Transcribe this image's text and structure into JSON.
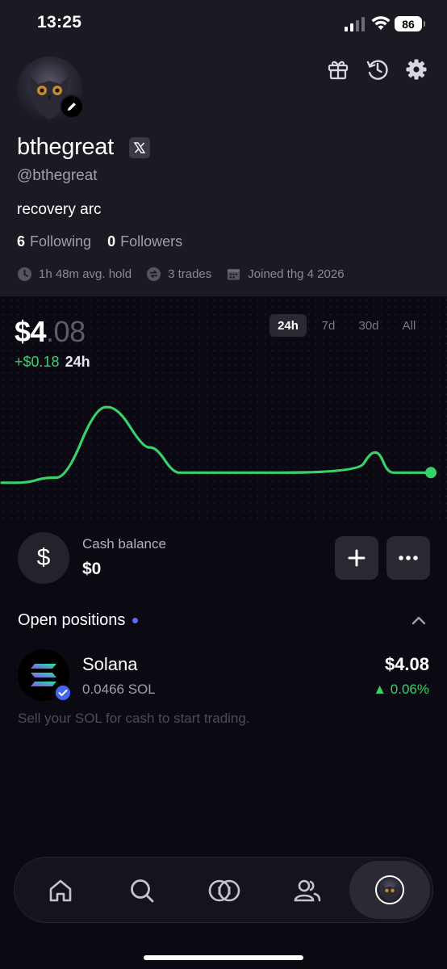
{
  "status_bar": {
    "time": "13:25",
    "battery": "86"
  },
  "profile": {
    "username": "bthegreat",
    "handle": "@bthegreat",
    "bio": "recovery arc",
    "following_count": "6",
    "following_label": "Following",
    "followers_count": "0",
    "followers_label": "Followers",
    "stats": {
      "avg_hold": "1h 48m avg. hold",
      "trades": "3 trades",
      "joined": "Joined thg 4 2026"
    }
  },
  "portfolio": {
    "value_main": "$4",
    "value_cents": ".08",
    "change": "+$0.18",
    "change_period": "24h",
    "ranges": [
      "24h",
      "7d",
      "30d",
      "All"
    ],
    "selected_range": "24h",
    "line_color": "#3ad06a"
  },
  "chart_data": {
    "type": "line",
    "title": "",
    "xlabel": "",
    "ylabel": "",
    "x": [
      0,
      6,
      10,
      15,
      22,
      27,
      33,
      36,
      40,
      43,
      83,
      86,
      88,
      90,
      93,
      100
    ],
    "values": [
      4.0,
      4.0,
      4.01,
      4.01,
      4.15,
      4.15,
      4.07,
      4.07,
      4.02,
      4.02,
      4.02,
      4.06,
      4.06,
      4.02,
      4.02,
      4.02
    ],
    "ylim": [
      3.99,
      4.16
    ],
    "grid": false,
    "legend": "none"
  },
  "cash": {
    "label": "Cash balance",
    "value": "$0",
    "symbol": "$"
  },
  "positions": {
    "title": "Open positions",
    "items": [
      {
        "name": "Solana",
        "amount": "0.0466 SOL",
        "value": "$4.08",
        "change": "0.06%"
      }
    ],
    "hint": "Sell your SOL for cash to start trading."
  },
  "nav": {
    "items": [
      "home-icon",
      "search-icon",
      "trade-icon",
      "people-icon",
      "profile-avatar"
    ]
  }
}
